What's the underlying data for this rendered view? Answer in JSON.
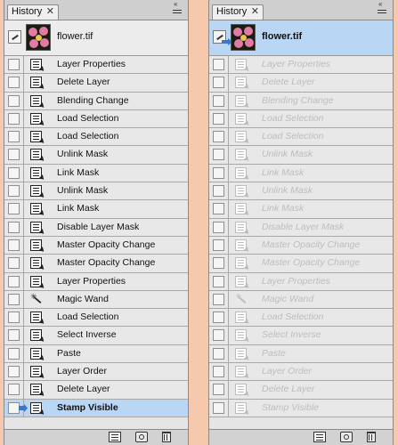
{
  "panels": [
    {
      "tab_label": "History",
      "snapshot_label": "flower.tif",
      "selected_index": 19,
      "state": "active"
    },
    {
      "tab_label": "History",
      "snapshot_label": "flower.tif",
      "selected_index": -1,
      "state": "reverted-to-snapshot"
    }
  ],
  "history_items": [
    {
      "label": "Layer Properties",
      "icon": "history-state-icon"
    },
    {
      "label": "Delete Layer",
      "icon": "history-state-icon"
    },
    {
      "label": "Blending Change",
      "icon": "history-state-icon"
    },
    {
      "label": "Load Selection",
      "icon": "history-state-icon"
    },
    {
      "label": "Load Selection",
      "icon": "history-state-icon"
    },
    {
      "label": "Unlink Mask",
      "icon": "history-state-icon"
    },
    {
      "label": "Link Mask",
      "icon": "history-state-icon"
    },
    {
      "label": "Unlink Mask",
      "icon": "history-state-icon"
    },
    {
      "label": "Link Mask",
      "icon": "history-state-icon"
    },
    {
      "label": "Disable Layer Mask",
      "icon": "history-state-icon"
    },
    {
      "label": "Master Opacity Change",
      "icon": "history-state-icon"
    },
    {
      "label": "Master Opacity Change",
      "icon": "history-state-icon"
    },
    {
      "label": "Layer Properties",
      "icon": "history-state-icon"
    },
    {
      "label": "Magic Wand",
      "icon": "magic-wand-icon"
    },
    {
      "label": "Load Selection",
      "icon": "history-state-icon"
    },
    {
      "label": "Select Inverse",
      "icon": "history-state-icon"
    },
    {
      "label": "Paste",
      "icon": "history-state-icon"
    },
    {
      "label": "Layer Order",
      "icon": "history-state-icon"
    },
    {
      "label": "Delete Layer",
      "icon": "history-state-icon"
    },
    {
      "label": "Stamp Visible",
      "icon": "history-state-icon"
    }
  ],
  "colors": {
    "background": "#f6c8ad",
    "selected_row": "#b9d6f5",
    "dimmed_text": "#bdbdbd"
  },
  "footer_buttons": [
    "new-document-from-state-icon",
    "create-snapshot-icon",
    "delete-state-icon"
  ]
}
